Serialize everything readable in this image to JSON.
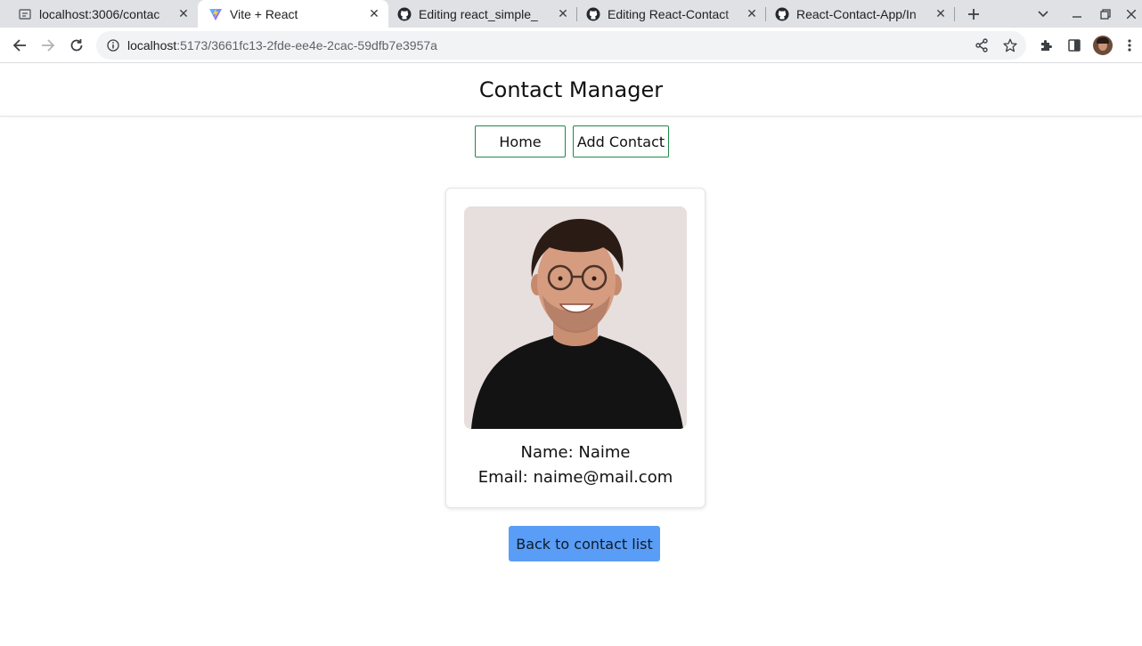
{
  "browser": {
    "tabs": [
      {
        "title": "localhost:3006/contac",
        "icon": "page-icon"
      },
      {
        "title": "Vite + React",
        "icon": "vite-icon",
        "active": true
      },
      {
        "title": "Editing react_simple_",
        "icon": "github-icon"
      },
      {
        "title": "Editing React-Contact",
        "icon": "github-icon"
      },
      {
        "title": "React-Contact-App/In",
        "icon": "github-icon"
      }
    ],
    "url_host": "localhost",
    "url_rest": ":5173/3661fc13-2fde-ee4e-2cac-59dfb7e3957a"
  },
  "app": {
    "title": "Contact Manager",
    "nav": {
      "home_label": "Home",
      "add_label": "Add Contact"
    },
    "contact": {
      "name_line": "Name: Naime",
      "email_line": "Email: naime@mail.com"
    },
    "back_label": "Back to contact list"
  },
  "colors": {
    "nav_border": "#1e8a46",
    "back_button": "#5a9df6",
    "tabbar": "#dfe1e5"
  }
}
